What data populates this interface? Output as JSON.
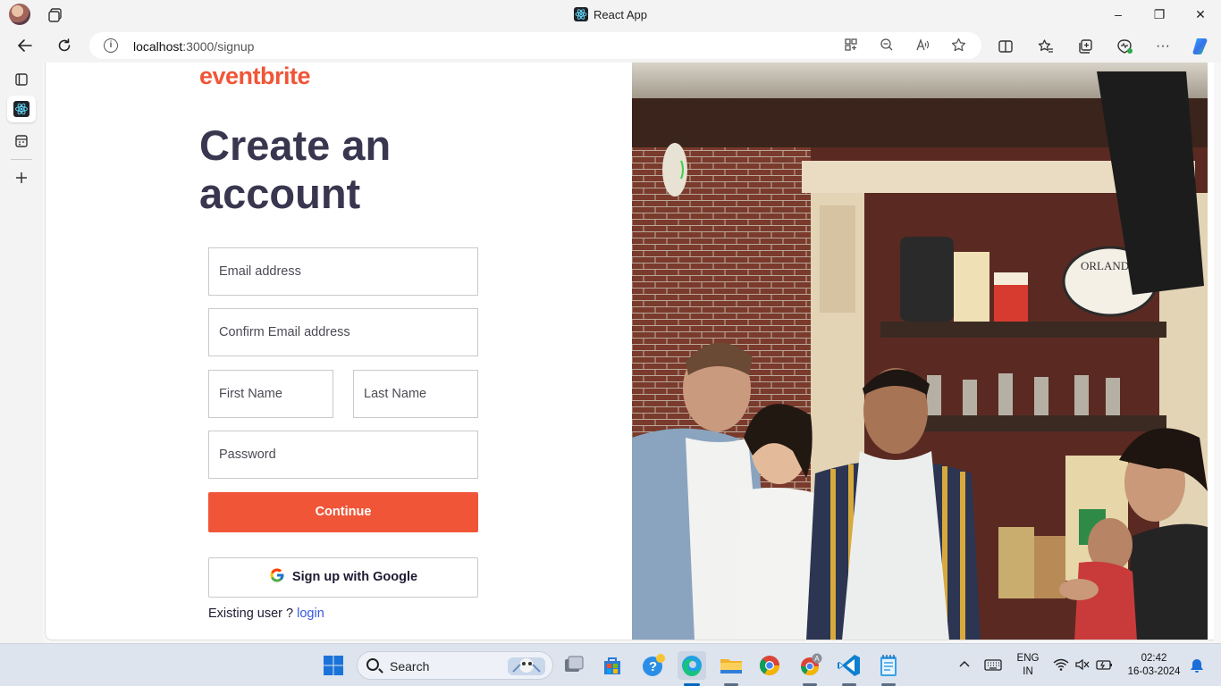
{
  "browser": {
    "window_title": "React App",
    "url_host": "localhost",
    "url_path": ":3000/signup",
    "window_controls": {
      "minimize": "–",
      "maximize": "❐",
      "close": "✕"
    }
  },
  "page": {
    "logo": "eventbrite",
    "heading": "Create an account",
    "fields": {
      "email_placeholder": "Email address",
      "confirm_email_placeholder": "Confirm Email address",
      "first_name_placeholder": "First Name",
      "last_name_placeholder": "Last Name",
      "password_placeholder": "Password"
    },
    "continue_label": "Continue",
    "google_label": "Sign up with Google",
    "existing_text": "Existing user ? ",
    "login_link": "login",
    "colors": {
      "brand": "#f05537",
      "heading": "#39364f",
      "link": "#3659e3"
    }
  },
  "taskbar": {
    "search_label": "Search",
    "lang_primary": "ENG",
    "lang_secondary": "IN",
    "time": "02:42",
    "date": "16-03-2024"
  }
}
